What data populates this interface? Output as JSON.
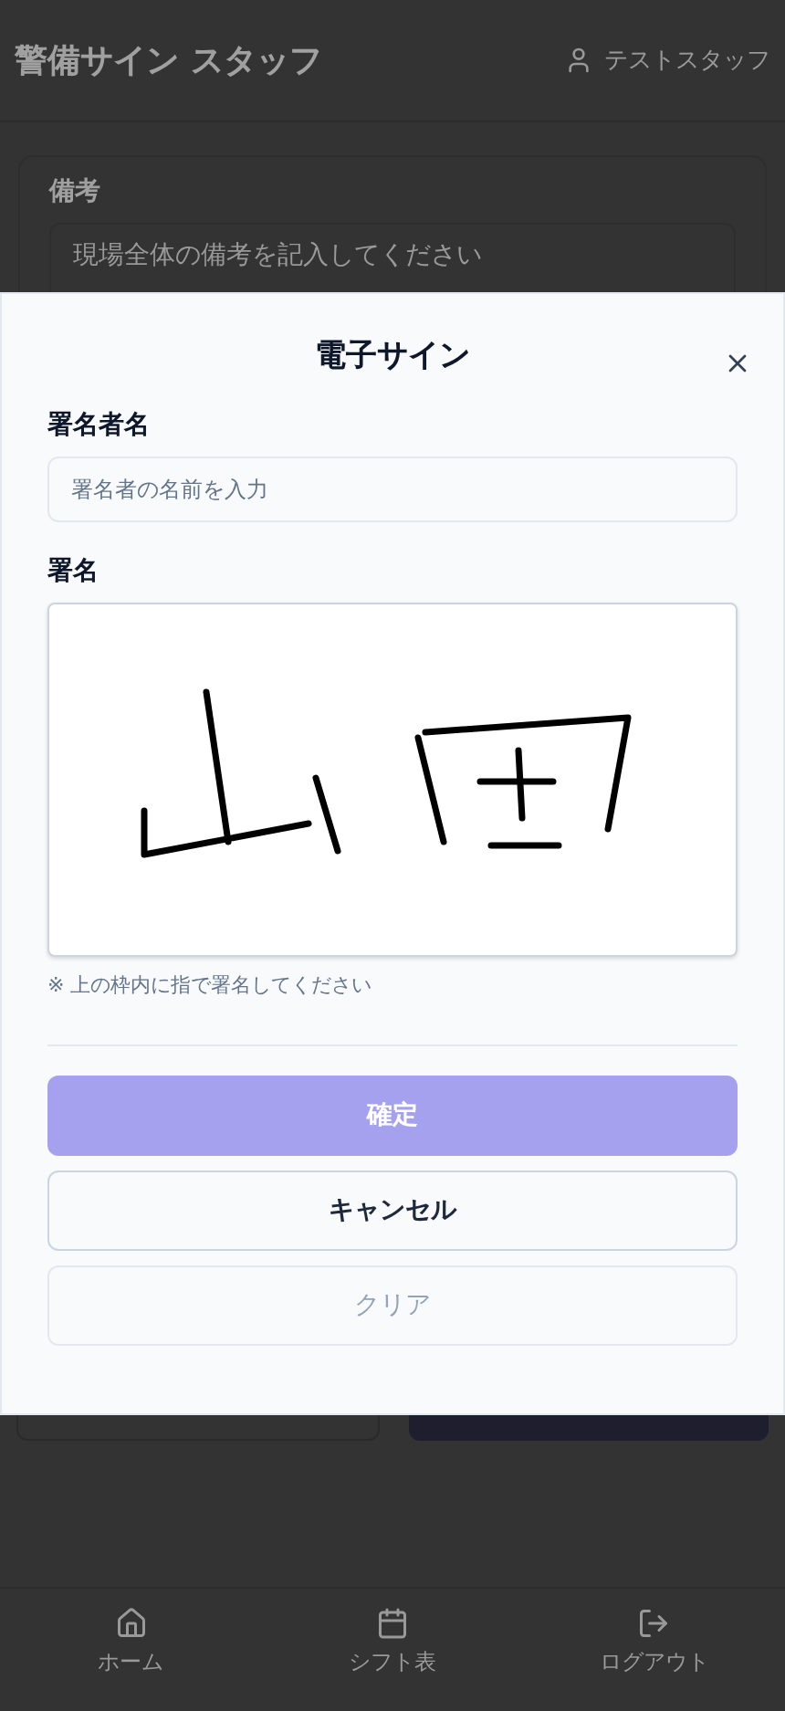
{
  "header": {
    "title": "警備サイン スタッフ",
    "user": "テストスタッフ"
  },
  "notes_card": {
    "label": "備考",
    "placeholder": "現場全体の備考を記入してください"
  },
  "modal": {
    "title": "電子サイン",
    "signer_label": "署名者名",
    "signer_placeholder": "署名者の名前を入力",
    "signature_label": "署名",
    "hint": "※ 上の枠内に指で署名してください",
    "buttons": [
      {
        "label": "確定",
        "kind": "primary",
        "disabled": true
      },
      {
        "label": "キャンセル",
        "kind": "outline",
        "disabled": false
      },
      {
        "label": "クリア",
        "kind": "outline",
        "disabled": true
      }
    ]
  },
  "nav": [
    {
      "label": "ホーム"
    },
    {
      "label": "シフト表"
    },
    {
      "label": "ログアウト"
    }
  ]
}
